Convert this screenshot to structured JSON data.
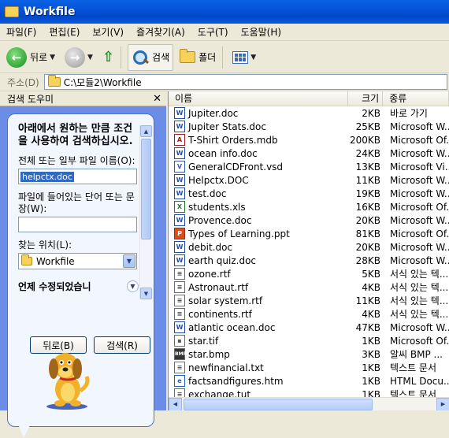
{
  "window": {
    "title": "Workfile"
  },
  "menu": [
    "파일(F)",
    "편집(E)",
    "보기(V)",
    "즐겨찾기(A)",
    "도구(T)",
    "도움말(H)"
  ],
  "toolbar": {
    "back": "뒤로",
    "search": "검색",
    "folders": "폴더"
  },
  "address": {
    "label": "주소(D)",
    "path": "C:\\모듈2\\Workfile"
  },
  "search_pane": {
    "title": "검색 도우미",
    "heading": "아래에서 원하는 만큼 조건을 사용하여 검색하십시오.",
    "name_label": "전체 또는 일부 파일 이름(O):",
    "name_value": "helpctx.doc",
    "word_label": "파일에 들어있는 단어 또는 문장(W):",
    "word_value": "",
    "location_label": "찾는 위치(L):",
    "location_value": "Workfile",
    "more_options": "언제 수정되었습니",
    "back_button": "뒤로(B)",
    "search_button": "검색(R)"
  },
  "columns": {
    "name": "이름",
    "size": "크기",
    "type": "종류"
  },
  "files": [
    {
      "name": "Jupiter.doc",
      "size": "2KB",
      "type": "바로 가기",
      "icon": "word"
    },
    {
      "name": "Jupiter Stats.doc",
      "size": "25KB",
      "type": "Microsoft W...",
      "icon": "word"
    },
    {
      "name": "T-Shirt Orders.mdb",
      "size": "200KB",
      "type": "Microsoft Of...",
      "icon": "access"
    },
    {
      "name": "ocean info.doc",
      "size": "24KB",
      "type": "Microsoft W...",
      "icon": "word"
    },
    {
      "name": "GeneralCDFront.vsd",
      "size": "13KB",
      "type": "Microsoft Vi...",
      "icon": "visio"
    },
    {
      "name": "Helpctx.DOC",
      "size": "11KB",
      "type": "Microsoft W...",
      "icon": "word"
    },
    {
      "name": "test.doc",
      "size": "19KB",
      "type": "Microsoft W...",
      "icon": "word"
    },
    {
      "name": "students.xls",
      "size": "16KB",
      "type": "Microsoft Of...",
      "icon": "excel"
    },
    {
      "name": "Provence.doc",
      "size": "20KB",
      "type": "Microsoft W...",
      "icon": "word"
    },
    {
      "name": "Types of Learning.ppt",
      "size": "81KB",
      "type": "Microsoft Of...",
      "icon": "ppt"
    },
    {
      "name": "debit.doc",
      "size": "20KB",
      "type": "Microsoft W...",
      "icon": "word"
    },
    {
      "name": "earth quiz.doc",
      "size": "28KB",
      "type": "Microsoft W...",
      "icon": "word"
    },
    {
      "name": "ozone.rtf",
      "size": "5KB",
      "type": "서식 있는 텍...",
      "icon": "rtf"
    },
    {
      "name": "Astronaut.rtf",
      "size": "4KB",
      "type": "서식 있는 텍...",
      "icon": "rtf"
    },
    {
      "name": "solar system.rtf",
      "size": "11KB",
      "type": "서식 있는 텍...",
      "icon": "rtf"
    },
    {
      "name": "continents.rtf",
      "size": "4KB",
      "type": "서식 있는 텍...",
      "icon": "rtf"
    },
    {
      "name": "atlantic ocean.doc",
      "size": "47KB",
      "type": "Microsoft W...",
      "icon": "word"
    },
    {
      "name": "star.tif",
      "size": "1KB",
      "type": "Microsoft Of...",
      "icon": "img"
    },
    {
      "name": "star.bmp",
      "size": "3KB",
      "type": "알씨 BMP ...",
      "icon": "bmp"
    },
    {
      "name": "newfinancial.txt",
      "size": "1KB",
      "type": "텍스트 문서",
      "icon": "txt"
    },
    {
      "name": "factsandfigures.htm",
      "size": "1KB",
      "type": "HTML Docu...",
      "icon": "htm"
    },
    {
      "name": "exchange.tut",
      "size": "1KB",
      "type": "텍스트 문서",
      "icon": "tut"
    }
  ],
  "icon_glyphs": {
    "word": "W",
    "excel": "X",
    "access": "A",
    "ppt": "P",
    "visio": "V",
    "rtf": "≡",
    "img": "▪",
    "bmp": "BMP",
    "txt": "≡",
    "htm": "e",
    "tut": "≡"
  },
  "colors": {
    "title_bar": "#0453d8",
    "pane_bg": "#6b8de8",
    "selection": "#316ac5"
  }
}
